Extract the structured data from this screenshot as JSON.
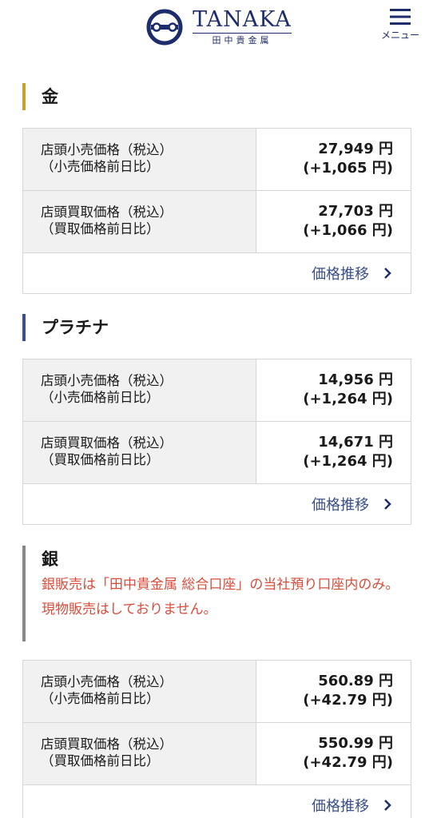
{
  "header": {
    "logo_name": "TANAKA",
    "logo_sub": "田中貴金属",
    "menu_label": "メニュー"
  },
  "gold": {
    "title": "金",
    "retail_label_1": "店頭小売価格（税込）",
    "retail_label_2": "（小売価格前日比）",
    "retail_price": "27,949 円",
    "retail_change": "(+1,065 円)",
    "buy_label_1": "店頭買取価格（税込）",
    "buy_label_2": "（買取価格前日比）",
    "buy_price": "27,703 円",
    "buy_change": "(+1,066 円)",
    "trend_link": "価格推移"
  },
  "platinum": {
    "title": "プラチナ",
    "retail_label_1": "店頭小売価格（税込）",
    "retail_label_2": "（小売価格前日比）",
    "retail_price": "14,956 円",
    "retail_change": "(+1,264 円)",
    "buy_label_1": "店頭買取価格（税込）",
    "buy_label_2": "（買取価格前日比）",
    "buy_price": "14,671 円",
    "buy_change": "(+1,264 円)",
    "trend_link": "価格推移"
  },
  "silver": {
    "title": "銀",
    "note_1": "銀販売は「田中貴金属 総合口座」の当社預り口座内のみ。",
    "note_2": "現物販売はしておりません。",
    "retail_label_1": "店頭小売価格（税込）",
    "retail_label_2": "（小売価格前日比）",
    "retail_price": "560.89 円",
    "retail_change": "(+42.79 円)",
    "buy_label_1": "店頭買取価格（税込）",
    "buy_label_2": "（買取価格前日比）",
    "buy_price": "550.99 円",
    "buy_change": "(+42.79 円)",
    "trend_link": "価格推移"
  },
  "colors": {
    "brand_navy": "#1d2c6b",
    "gold_accent": "#c9a227",
    "platinum_accent": "#3b4f8c",
    "silver_accent": "#888888",
    "notice_red": "#d94c3a",
    "link_blue": "#3a4f8a"
  }
}
